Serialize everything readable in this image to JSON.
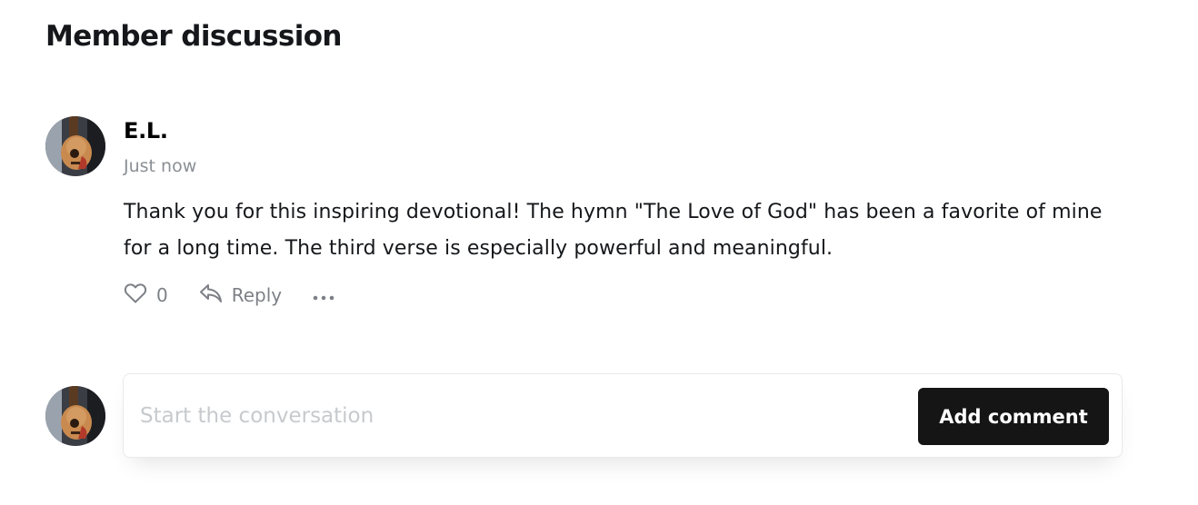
{
  "section": {
    "title": "Member discussion"
  },
  "comment": {
    "author": "E.L.",
    "timestamp": "Just now",
    "body": "Thank you for this inspiring devotional! The hymn \"The Love of God\" has been a favorite of mine for a long time. The third verse is especially powerful and meaningful.",
    "like_count": "0",
    "reply_label": "Reply",
    "icons": {
      "like": "heart-icon",
      "reply": "reply-arrow-icon",
      "more": "ellipsis-icon"
    }
  },
  "form": {
    "placeholder": "Start the conversation",
    "value": "",
    "submit_label": "Add comment"
  },
  "colors": {
    "text": "#15171a",
    "muted": "#8a8f95",
    "button_bg": "#151515",
    "button_text": "#ffffff"
  }
}
